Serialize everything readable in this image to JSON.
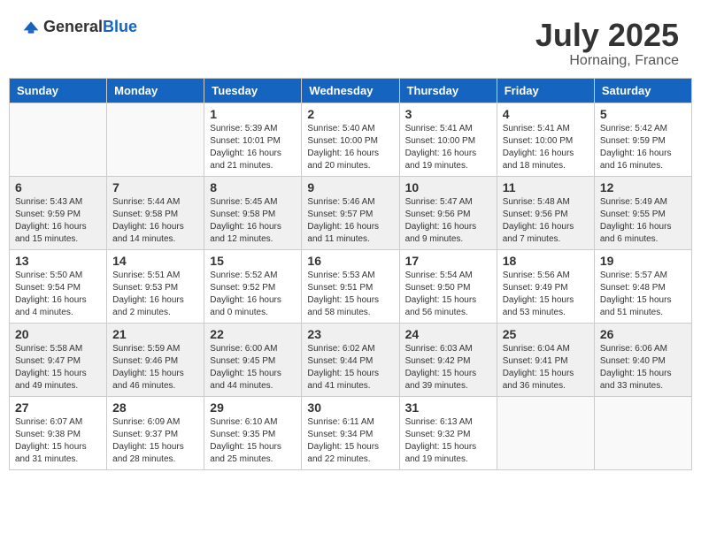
{
  "header": {
    "logo_general": "General",
    "logo_blue": "Blue",
    "month": "July 2025",
    "location": "Hornaing, France"
  },
  "weekdays": [
    "Sunday",
    "Monday",
    "Tuesday",
    "Wednesday",
    "Thursday",
    "Friday",
    "Saturday"
  ],
  "weeks": [
    [
      {
        "day": "",
        "info": ""
      },
      {
        "day": "",
        "info": ""
      },
      {
        "day": "1",
        "info": "Sunrise: 5:39 AM\nSunset: 10:01 PM\nDaylight: 16 hours\nand 21 minutes."
      },
      {
        "day": "2",
        "info": "Sunrise: 5:40 AM\nSunset: 10:00 PM\nDaylight: 16 hours\nand 20 minutes."
      },
      {
        "day": "3",
        "info": "Sunrise: 5:41 AM\nSunset: 10:00 PM\nDaylight: 16 hours\nand 19 minutes."
      },
      {
        "day": "4",
        "info": "Sunrise: 5:41 AM\nSunset: 10:00 PM\nDaylight: 16 hours\nand 18 minutes."
      },
      {
        "day": "5",
        "info": "Sunrise: 5:42 AM\nSunset: 9:59 PM\nDaylight: 16 hours\nand 16 minutes."
      }
    ],
    [
      {
        "day": "6",
        "info": "Sunrise: 5:43 AM\nSunset: 9:59 PM\nDaylight: 16 hours\nand 15 minutes."
      },
      {
        "day": "7",
        "info": "Sunrise: 5:44 AM\nSunset: 9:58 PM\nDaylight: 16 hours\nand 14 minutes."
      },
      {
        "day": "8",
        "info": "Sunrise: 5:45 AM\nSunset: 9:58 PM\nDaylight: 16 hours\nand 12 minutes."
      },
      {
        "day": "9",
        "info": "Sunrise: 5:46 AM\nSunset: 9:57 PM\nDaylight: 16 hours\nand 11 minutes."
      },
      {
        "day": "10",
        "info": "Sunrise: 5:47 AM\nSunset: 9:56 PM\nDaylight: 16 hours\nand 9 minutes."
      },
      {
        "day": "11",
        "info": "Sunrise: 5:48 AM\nSunset: 9:56 PM\nDaylight: 16 hours\nand 7 minutes."
      },
      {
        "day": "12",
        "info": "Sunrise: 5:49 AM\nSunset: 9:55 PM\nDaylight: 16 hours\nand 6 minutes."
      }
    ],
    [
      {
        "day": "13",
        "info": "Sunrise: 5:50 AM\nSunset: 9:54 PM\nDaylight: 16 hours\nand 4 minutes."
      },
      {
        "day": "14",
        "info": "Sunrise: 5:51 AM\nSunset: 9:53 PM\nDaylight: 16 hours\nand 2 minutes."
      },
      {
        "day": "15",
        "info": "Sunrise: 5:52 AM\nSunset: 9:52 PM\nDaylight: 16 hours\nand 0 minutes."
      },
      {
        "day": "16",
        "info": "Sunrise: 5:53 AM\nSunset: 9:51 PM\nDaylight: 15 hours\nand 58 minutes."
      },
      {
        "day": "17",
        "info": "Sunrise: 5:54 AM\nSunset: 9:50 PM\nDaylight: 15 hours\nand 56 minutes."
      },
      {
        "day": "18",
        "info": "Sunrise: 5:56 AM\nSunset: 9:49 PM\nDaylight: 15 hours\nand 53 minutes."
      },
      {
        "day": "19",
        "info": "Sunrise: 5:57 AM\nSunset: 9:48 PM\nDaylight: 15 hours\nand 51 minutes."
      }
    ],
    [
      {
        "day": "20",
        "info": "Sunrise: 5:58 AM\nSunset: 9:47 PM\nDaylight: 15 hours\nand 49 minutes."
      },
      {
        "day": "21",
        "info": "Sunrise: 5:59 AM\nSunset: 9:46 PM\nDaylight: 15 hours\nand 46 minutes."
      },
      {
        "day": "22",
        "info": "Sunrise: 6:00 AM\nSunset: 9:45 PM\nDaylight: 15 hours\nand 44 minutes."
      },
      {
        "day": "23",
        "info": "Sunrise: 6:02 AM\nSunset: 9:44 PM\nDaylight: 15 hours\nand 41 minutes."
      },
      {
        "day": "24",
        "info": "Sunrise: 6:03 AM\nSunset: 9:42 PM\nDaylight: 15 hours\nand 39 minutes."
      },
      {
        "day": "25",
        "info": "Sunrise: 6:04 AM\nSunset: 9:41 PM\nDaylight: 15 hours\nand 36 minutes."
      },
      {
        "day": "26",
        "info": "Sunrise: 6:06 AM\nSunset: 9:40 PM\nDaylight: 15 hours\nand 33 minutes."
      }
    ],
    [
      {
        "day": "27",
        "info": "Sunrise: 6:07 AM\nSunset: 9:38 PM\nDaylight: 15 hours\nand 31 minutes."
      },
      {
        "day": "28",
        "info": "Sunrise: 6:09 AM\nSunset: 9:37 PM\nDaylight: 15 hours\nand 28 minutes."
      },
      {
        "day": "29",
        "info": "Sunrise: 6:10 AM\nSunset: 9:35 PM\nDaylight: 15 hours\nand 25 minutes."
      },
      {
        "day": "30",
        "info": "Sunrise: 6:11 AM\nSunset: 9:34 PM\nDaylight: 15 hours\nand 22 minutes."
      },
      {
        "day": "31",
        "info": "Sunrise: 6:13 AM\nSunset: 9:32 PM\nDaylight: 15 hours\nand 19 minutes."
      },
      {
        "day": "",
        "info": ""
      },
      {
        "day": "",
        "info": ""
      }
    ]
  ]
}
